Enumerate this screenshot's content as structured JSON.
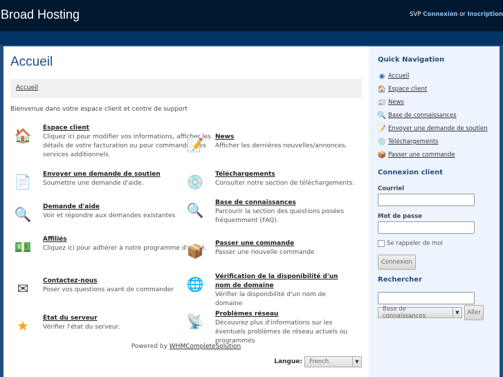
{
  "header": {
    "brand": "Broad Hosting",
    "auth_prefix": "SVP",
    "login": "Connexion",
    "or": "or",
    "register": "Inscription"
  },
  "main": {
    "title": "Accueil",
    "breadcrumb": "Accueil",
    "welcome": "Bienvenue dans votre espace client et centre de support",
    "items": [
      {
        "title": "Espace client",
        "desc": "Cliquez ici pour modifier vos informations, afficher les détails de votre facturation ou pour commander des services additionnels.",
        "icon": "house-icon"
      },
      {
        "title": "News",
        "desc": "Afficher les dernières nouvelles/annonces.",
        "icon": "notepad-icon"
      },
      {
        "title": "Envoyer une demande de soutien",
        "desc": "Soumettre une demande d'aide.",
        "icon": "document-pen-icon"
      },
      {
        "title": "Téléchargements",
        "desc": "Consulter notre section de téléchargements.",
        "icon": "cd-icon"
      },
      {
        "title": "Demande d'aide",
        "desc": "Voir et répondre aux demandes existantes",
        "icon": "magnifier-document-icon"
      },
      {
        "title": "Base de connaissances",
        "desc": "Parcourir la section des questions posées fréquemment (FAQ).",
        "icon": "magnifier-icon"
      },
      {
        "title": "Affiliés",
        "desc": "Cliquez ici pour adhérer à notre programme d'affilié.",
        "icon": "money-icon"
      },
      {
        "title": "Passer une commande",
        "desc": "Passer une nouvelle commande",
        "icon": "package-icon"
      },
      {
        "title": "Contactez-nous",
        "desc": "Poser vos questions avant de commander",
        "icon": "mail-arrow-icon"
      },
      {
        "title": "Vérification de la disponibilité d'un nom de domaine",
        "desc": "Vérifier la disponibilité d'un nom de domaine",
        "icon": "globe-icon"
      },
      {
        "title": "État du serveur",
        "desc": "Vérifier l'état du serveur.",
        "icon": "star-icon"
      },
      {
        "title": "Problèmes réseau",
        "desc": "Découvrez plus d'informations sur les éventuels problèmes de réseau actuels ou programmés",
        "icon": "antenna-icon"
      }
    ],
    "powered_prefix": "Powered by",
    "powered_link": "WHMCompleteSolution",
    "language_label": "Langue:",
    "language_value": "French"
  },
  "sidebar": {
    "quick_nav_title": "Quick Navigation",
    "quick_nav": [
      {
        "label": "Accueil",
        "icon": "home-globe-icon"
      },
      {
        "label": "Espace client",
        "icon": "house-icon"
      },
      {
        "label": "News",
        "icon": "news-icon"
      },
      {
        "label": "Base de connaissances",
        "icon": "magnifier-icon"
      },
      {
        "label": "Envoyer une demande de soutien",
        "icon": "document-pen-icon"
      },
      {
        "label": "Téléchargements",
        "icon": "cd-icon"
      },
      {
        "label": "Passer une commande",
        "icon": "package-icon"
      }
    ],
    "login_title": "Connexion client",
    "email_label": "Courriel",
    "email_value": "",
    "password_label": "Mot de passe",
    "password_value": "",
    "remember_label": "Se rappeler de moi",
    "login_button": "Connexion",
    "search_title": "Rechercher",
    "search_value": "",
    "search_scope": "Base de connaissances",
    "search_button": "Aller"
  }
}
